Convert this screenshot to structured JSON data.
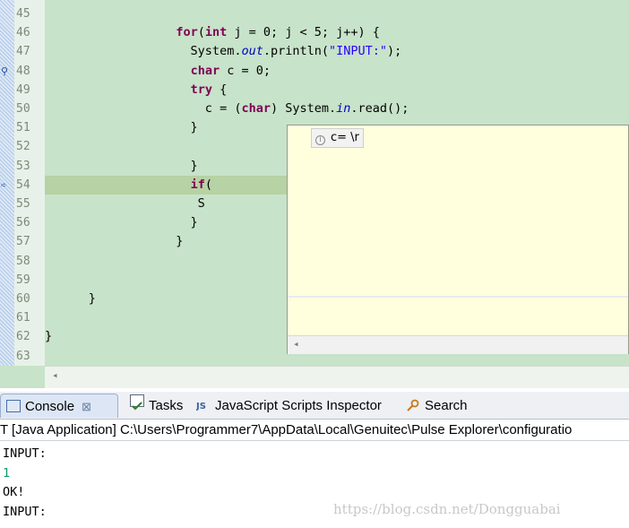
{
  "editor": {
    "lines": [
      {
        "num": "45",
        "parts": []
      },
      {
        "num": "46",
        "parts": [
          {
            "t": "                  "
          },
          {
            "t": "for",
            "c": "kw"
          },
          {
            "t": "("
          },
          {
            "t": "int",
            "c": "kw"
          },
          {
            "t": " j = 0; j < 5; j++) {"
          }
        ]
      },
      {
        "num": "47",
        "parts": [
          {
            "t": "                    System."
          },
          {
            "t": "out",
            "c": "fld"
          },
          {
            "t": ".println("
          },
          {
            "t": "\"INPUT:\"",
            "c": "str"
          },
          {
            "t": ");"
          }
        ]
      },
      {
        "num": "48",
        "parts": [
          {
            "t": "                    "
          },
          {
            "t": "char",
            "c": "kw"
          },
          {
            "t": " c = 0;"
          }
        ]
      },
      {
        "num": "49",
        "parts": [
          {
            "t": "                    "
          },
          {
            "t": "try",
            "c": "kw"
          },
          {
            "t": " {"
          }
        ]
      },
      {
        "num": "50",
        "parts": [
          {
            "t": "                      c = ("
          },
          {
            "t": "char",
            "c": "kw"
          },
          {
            "t": ") System."
          },
          {
            "t": "in",
            "c": "fld"
          },
          {
            "t": ".read();"
          }
        ]
      },
      {
        "num": "51",
        "parts": [
          {
            "t": "                    }"
          }
        ]
      },
      {
        "num": "52",
        "parts": []
      },
      {
        "num": "53",
        "parts": [
          {
            "t": "                    }"
          }
        ]
      },
      {
        "num": "54",
        "parts": [
          {
            "t": "                    "
          },
          {
            "t": "if",
            "c": "kw"
          },
          {
            "t": "("
          }
        ]
      },
      {
        "num": "55",
        "parts": [
          {
            "t": "                     S"
          }
        ]
      },
      {
        "num": "56",
        "parts": [
          {
            "t": "                    }"
          }
        ]
      },
      {
        "num": "57",
        "parts": [
          {
            "t": "                  }"
          }
        ]
      },
      {
        "num": "58",
        "parts": []
      },
      {
        "num": "59",
        "parts": []
      },
      {
        "num": "60",
        "parts": [
          {
            "t": "      }"
          }
        ]
      },
      {
        "num": "61",
        "parts": []
      },
      {
        "num": "62",
        "parts": [
          {
            "t": "}"
          }
        ]
      },
      {
        "num": "63",
        "parts": []
      }
    ]
  },
  "hover": {
    "text": "c= \\r"
  },
  "tabs": {
    "console": "Console",
    "close": "⊠",
    "tasks": "Tasks",
    "inspector": "JavaScript Scripts Inspector",
    "search": "Search"
  },
  "launch": "T [Java Application] C:\\Users\\Programmer7\\AppData\\Local\\Genuitec\\Pulse Explorer\\configuratio",
  "console": {
    "lines": [
      {
        "text": "INPUT:",
        "kind": "out"
      },
      {
        "text": "1",
        "kind": "input"
      },
      {
        "text": "OK!",
        "kind": "out"
      },
      {
        "text": "INPUT:",
        "kind": "out"
      }
    ]
  },
  "watermark": "https://blog.csdn.net/Dongguabai",
  "colors": {
    "editor_bg": "#c7e3c9",
    "current_line": "#b7d2a4",
    "keyword": "#7f0055",
    "field": "#0000c0",
    "string": "#2a00ff",
    "hover_bg": "#ffffde",
    "user_input": "#0a9d67"
  }
}
